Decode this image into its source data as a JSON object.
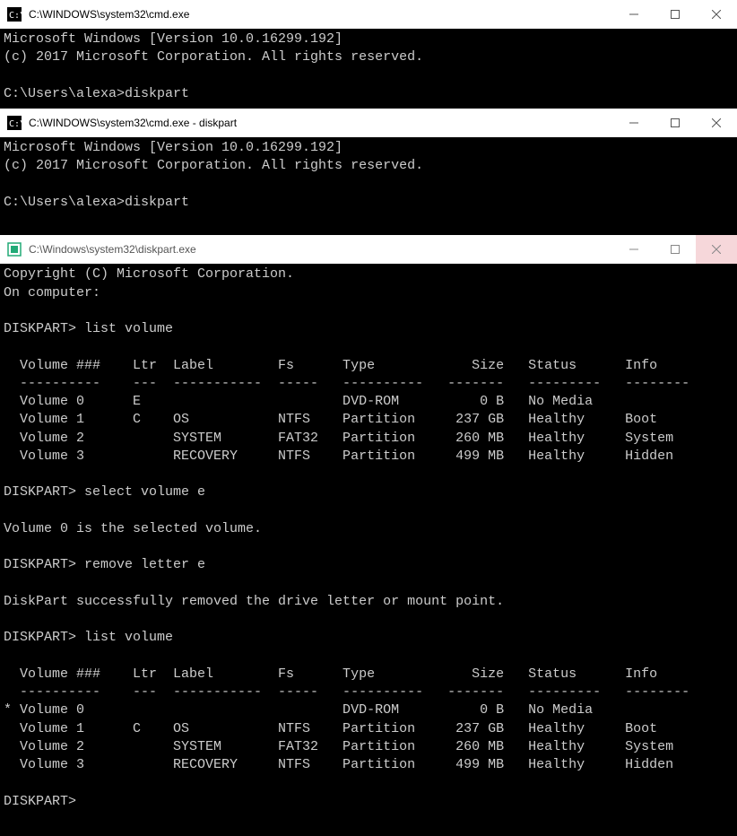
{
  "win1": {
    "title": "C:\\WINDOWS\\system32\\cmd.exe",
    "banner1": "Microsoft Windows [Version 10.0.16299.192]",
    "banner2": "(c) 2017 Microsoft Corporation. All rights reserved.",
    "prompt_line": "C:\\Users\\alexa>diskpart"
  },
  "win2": {
    "title": "C:\\WINDOWS\\system32\\cmd.exe - diskpart",
    "banner1": "Microsoft Windows [Version 10.0.16299.192]",
    "banner2": "(c) 2017 Microsoft Corporation. All rights reserved.",
    "prompt_line": "C:\\Users\\alexa>diskpart"
  },
  "win3": {
    "title": "C:\\Windows\\system32\\diskpart.exe",
    "copyright": "Copyright (C) Microsoft Corporation.",
    "on_computer_label": "On computer:",
    "prompt": "DISKPART>",
    "cmd_list1": "list volume",
    "cmd_select": "select volume e",
    "msg_selected": "Volume 0 is the selected volume.",
    "cmd_remove": "remove letter e",
    "msg_removed": "DiskPart successfully removed the drive letter or mount point.",
    "cmd_list2": "list volume",
    "table_header": {
      "vol": "Volume ###",
      "ltr": "Ltr",
      "label": "Label",
      "fs": "Fs",
      "type": "Type",
      "size": "Size",
      "status": "Status",
      "info": "Info"
    },
    "table_divider": {
      "vol": "----------",
      "ltr": "---",
      "label": "-----------",
      "fs": "-----",
      "type": "----------",
      "size": "-------",
      "status": "---------",
      "info": "--------"
    },
    "table1": [
      {
        "mark": " ",
        "vol": "Volume 0",
        "ltr": "E",
        "label": "",
        "fs": "",
        "type": "DVD-ROM",
        "size": "0 B",
        "status": "No Media",
        "info": ""
      },
      {
        "mark": " ",
        "vol": "Volume 1",
        "ltr": "C",
        "label": "OS",
        "fs": "NTFS",
        "type": "Partition",
        "size": "237 GB",
        "status": "Healthy",
        "info": "Boot"
      },
      {
        "mark": " ",
        "vol": "Volume 2",
        "ltr": "",
        "label": "SYSTEM",
        "fs": "FAT32",
        "type": "Partition",
        "size": "260 MB",
        "status": "Healthy",
        "info": "System"
      },
      {
        "mark": " ",
        "vol": "Volume 3",
        "ltr": "",
        "label": "RECOVERY",
        "fs": "NTFS",
        "type": "Partition",
        "size": "499 MB",
        "status": "Healthy",
        "info": "Hidden"
      }
    ],
    "table2": [
      {
        "mark": "*",
        "vol": "Volume 0",
        "ltr": "",
        "label": "",
        "fs": "",
        "type": "DVD-ROM",
        "size": "0 B",
        "status": "No Media",
        "info": ""
      },
      {
        "mark": " ",
        "vol": "Volume 1",
        "ltr": "C",
        "label": "OS",
        "fs": "NTFS",
        "type": "Partition",
        "size": "237 GB",
        "status": "Healthy",
        "info": "Boot"
      },
      {
        "mark": " ",
        "vol": "Volume 2",
        "ltr": "",
        "label": "SYSTEM",
        "fs": "FAT32",
        "type": "Partition",
        "size": "260 MB",
        "status": "Healthy",
        "info": "System"
      },
      {
        "mark": " ",
        "vol": "Volume 3",
        "ltr": "",
        "label": "RECOVERY",
        "fs": "NTFS",
        "type": "Partition",
        "size": "499 MB",
        "status": "Healthy",
        "info": "Hidden"
      }
    ]
  }
}
